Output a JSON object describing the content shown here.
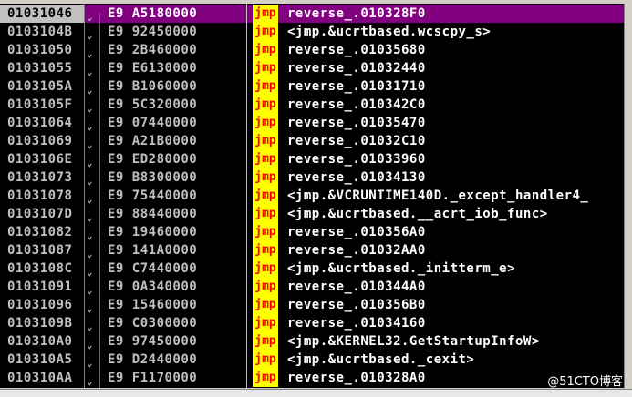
{
  "colors": {
    "selection": "#800080",
    "mnemonic_bg": "#ffff00",
    "mnemonic_fg": "#ff0000",
    "jump_line": "#ff2020"
  },
  "rows": [
    {
      "address": "01031046",
      "bytes": "E9 A5180000",
      "mnemonic": "jmp",
      "operand": "reverse_.010328F0",
      "selected": true
    },
    {
      "address": "0103104B",
      "bytes": "E9 92450000",
      "mnemonic": "jmp",
      "operand": "<jmp.&ucrtbased.wcscpy_s>"
    },
    {
      "address": "01031050",
      "bytes": "E9 2B460000",
      "mnemonic": "jmp",
      "operand": "reverse_.01035680"
    },
    {
      "address": "01031055",
      "bytes": "E9 E6130000",
      "mnemonic": "jmp",
      "operand": "reverse_.01032440"
    },
    {
      "address": "0103105A",
      "bytes": "E9 B1060000",
      "mnemonic": "jmp",
      "operand": "reverse_.01031710"
    },
    {
      "address": "0103105F",
      "bytes": "E9 5C320000",
      "mnemonic": "jmp",
      "operand": "reverse_.010342C0"
    },
    {
      "address": "01031064",
      "bytes": "E9 07440000",
      "mnemonic": "jmp",
      "operand": "reverse_.01035470"
    },
    {
      "address": "01031069",
      "bytes": "E9 A21B0000",
      "mnemonic": "jmp",
      "operand": "reverse_.01032C10"
    },
    {
      "address": "0103106E",
      "bytes": "E9 ED280000",
      "mnemonic": "jmp",
      "operand": "reverse_.01033960"
    },
    {
      "address": "01031073",
      "bytes": "E9 B8300000",
      "mnemonic": "jmp",
      "operand": "reverse_.01034130"
    },
    {
      "address": "01031078",
      "bytes": "E9 75440000",
      "mnemonic": "jmp",
      "operand": "<jmp.&VCRUNTIME140D._except_handler4_"
    },
    {
      "address": "0103107D",
      "bytes": "E9 88440000",
      "mnemonic": "jmp",
      "operand": "<jmp.&ucrtbased.__acrt_iob_func>"
    },
    {
      "address": "01031082",
      "bytes": "E9 19460000",
      "mnemonic": "jmp",
      "operand": "reverse_.010356A0"
    },
    {
      "address": "01031087",
      "bytes": "E9 141A0000",
      "mnemonic": "jmp",
      "operand": "reverse_.01032AA0"
    },
    {
      "address": "0103108C",
      "bytes": "E9 C7440000",
      "mnemonic": "jmp",
      "operand": "<jmp.&ucrtbased._initterm_e>"
    },
    {
      "address": "01031091",
      "bytes": "E9 0A340000",
      "mnemonic": "jmp",
      "operand": "reverse_.010344A0"
    },
    {
      "address": "01031096",
      "bytes": "E9 15460000",
      "mnemonic": "jmp",
      "operand": "reverse_.010356B0"
    },
    {
      "address": "0103109B",
      "bytes": "E9 C0300000",
      "mnemonic": "jmp",
      "operand": "reverse_.01034160"
    },
    {
      "address": "010310A0",
      "bytes": "E9 97450000",
      "mnemonic": "jmp",
      "operand": "<jmp.&KERNEL32.GetStartupInfoW>"
    },
    {
      "address": "010310A5",
      "bytes": "E9 D2440000",
      "mnemonic": "jmp",
      "operand": "<jmp.&ucrtbased._cexit>"
    },
    {
      "address": "010310AA",
      "bytes": "E9 F1170000",
      "mnemonic": "jmp",
      "operand": "reverse_.010328A0"
    }
  ],
  "watermark": "@51CTO博客"
}
